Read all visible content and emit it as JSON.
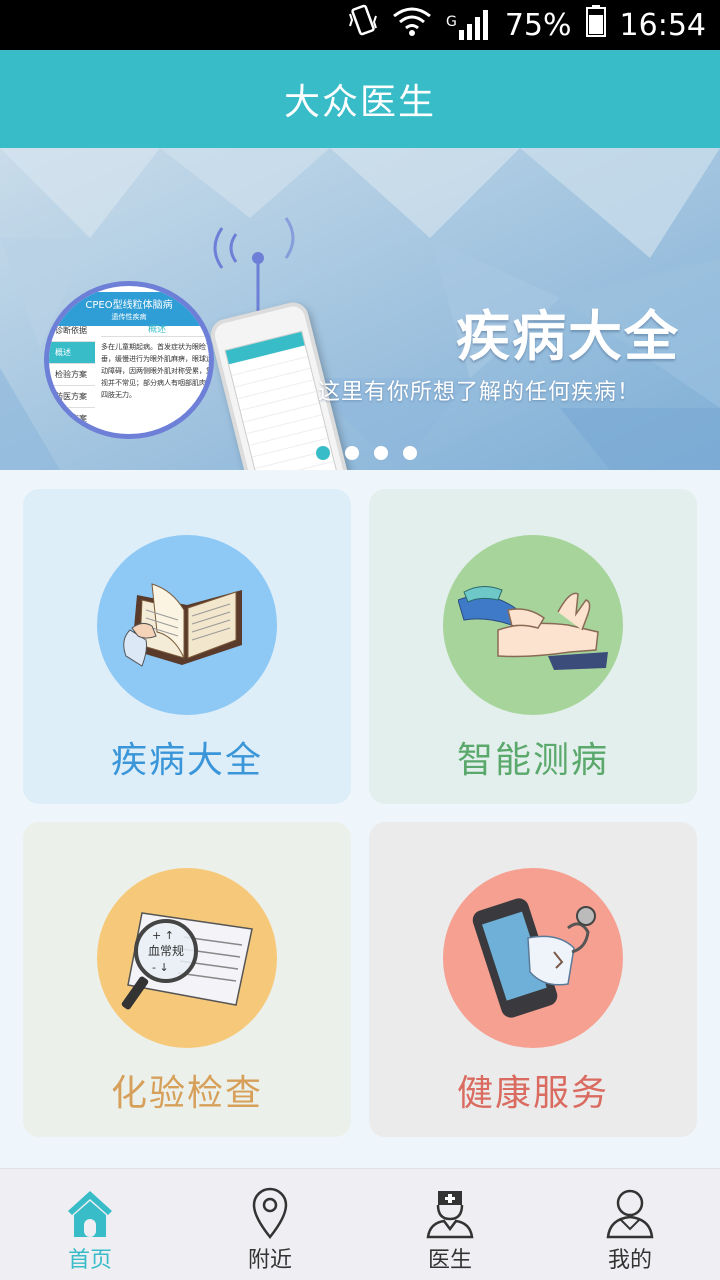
{
  "status_bar": {
    "network": "G",
    "battery": "75%",
    "time": "16:54"
  },
  "header": {
    "title": "大众医生"
  },
  "banner": {
    "headline": "疾病大全",
    "subtitle": "这里有你所想了解的任何疾病！",
    "magnifier": {
      "title": "CPEO型线粒体脑病",
      "subtitle": "遗传性疾病",
      "side_items": [
        "诊断依据",
        "概述",
        "检验方案",
        "药医方案",
        "治疗方案"
      ],
      "tag": "概述",
      "text": "多在儿童期起病。首发症状为眼睑下垂，缓慢进行为眼外肌麻痹，眼球运动障碍，因两侧眼外肌对称受累，复视并不常见；部分病人有咽部肌肉和四肢无力。"
    },
    "dots": [
      true,
      false,
      false,
      false
    ]
  },
  "grid": [
    {
      "label": "疾病大全",
      "circle_color": "#8ec8f5",
      "label_color": "#3a96d8",
      "icon": "book-icon"
    },
    {
      "label": "智能测病",
      "circle_color": "#a6d49a",
      "label_color": "#5aa86b",
      "icon": "pulse-check-icon"
    },
    {
      "label": "化验检查",
      "circle_color": "#f6c97a",
      "label_color": "#d6a05a",
      "icon": "magnifier-report-icon"
    },
    {
      "label": "健康服务",
      "circle_color": "#f5a090",
      "label_color": "#d96b60",
      "icon": "phone-stethoscope-icon"
    }
  ],
  "bottom_nav": [
    {
      "label": "首页",
      "icon": "home-icon",
      "active": true
    },
    {
      "label": "附近",
      "icon": "location-pin-icon",
      "active": false
    },
    {
      "label": "医生",
      "icon": "doctor-icon",
      "active": false
    },
    {
      "label": "我的",
      "icon": "user-icon",
      "active": false
    }
  ],
  "colors": {
    "accent": "#38bcc8",
    "status_bar": "#000000",
    "background": "#eef6fb"
  }
}
